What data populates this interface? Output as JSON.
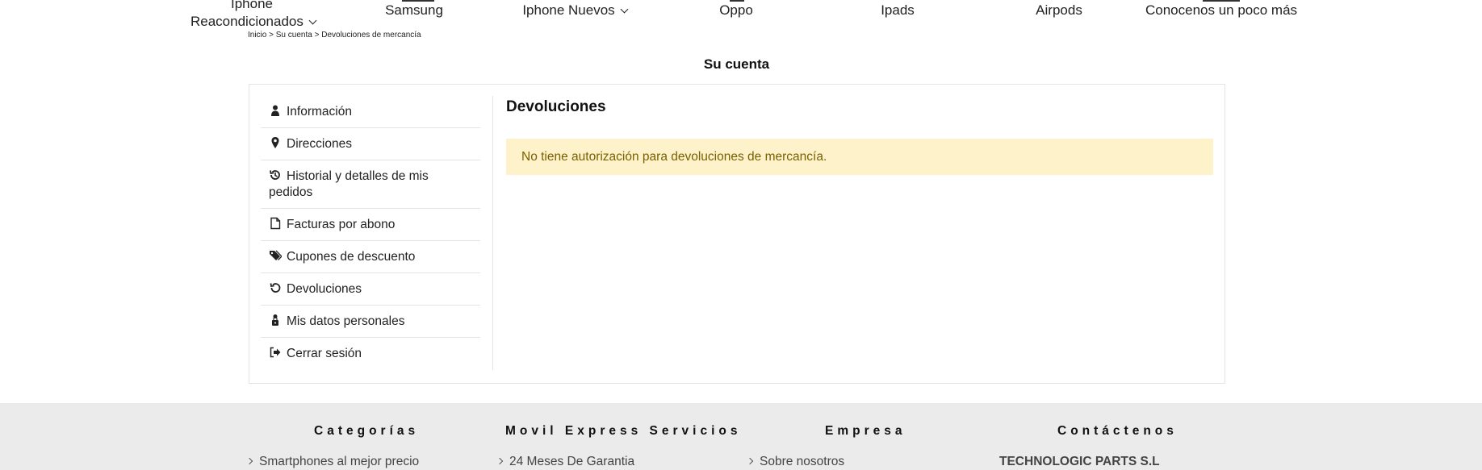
{
  "nav": {
    "items": [
      {
        "label_line1": "Iphone",
        "label_line2": "Reacondicionados"
      },
      {
        "label": "Samsung"
      },
      {
        "label": "Iphone Nuevos"
      },
      {
        "label": "Oppo"
      },
      {
        "label": "Ipads"
      },
      {
        "label": "Airpods"
      },
      {
        "label": "Conocenos un poco más"
      }
    ]
  },
  "breadcrumb": {
    "home": "Inicio",
    "sep": ">",
    "account": "Su cuenta",
    "current": "Devoluciones de mercancía"
  },
  "page_title": "Su cuenta",
  "sidebar": {
    "items": [
      {
        "label": "Información",
        "icon": "user-icon"
      },
      {
        "label": "Direcciones",
        "icon": "map-pin-icon"
      },
      {
        "label": "Historial y detalles de mis pedidos",
        "icon": "history-icon"
      },
      {
        "label": "Facturas por abono",
        "icon": "file-icon"
      },
      {
        "label": "Cupones de descuento",
        "icon": "tags-icon"
      },
      {
        "label": "Devoluciones",
        "icon": "undo-icon"
      },
      {
        "label": "Mis datos personales",
        "icon": "user-lock-icon"
      },
      {
        "label": "Cerrar sesión",
        "icon": "sign-out-icon"
      }
    ]
  },
  "content": {
    "heading": "Devoluciones",
    "alert": "No tiene autorización para devoluciones de mercancía."
  },
  "footer": {
    "columns": [
      {
        "title": "Categorías",
        "first_link": "Smartphones al mejor precio"
      },
      {
        "title": "Movil Express Servicios",
        "first_link": "24 Meses De Garantia"
      },
      {
        "title": "Empresa",
        "first_link": "Sobre nosotros"
      },
      {
        "title": "Contáctenos",
        "first_text": "TECHNOLOGIC PARTS S.L"
      }
    ]
  },
  "colors": {
    "alert_bg": "#fdf2c9",
    "alert_text": "#7a6000",
    "footer_bg": "#ebebeb",
    "border": "#e4e4e4"
  }
}
